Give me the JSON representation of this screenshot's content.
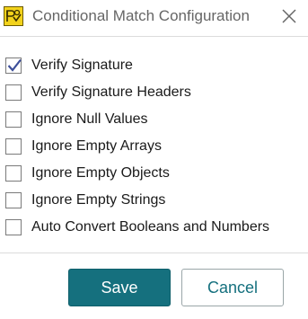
{
  "window": {
    "title": "Conditional Match Configuration",
    "icon": "app-logo-icon",
    "close_icon": "close-icon"
  },
  "options": [
    {
      "label": "Verify Signature",
      "checked": true
    },
    {
      "label": "Verify Signature Headers",
      "checked": false
    },
    {
      "label": "Ignore Null Values",
      "checked": false
    },
    {
      "label": "Ignore Empty Arrays",
      "checked": false
    },
    {
      "label": "Ignore Empty Objects",
      "checked": false
    },
    {
      "label": "Ignore Empty Strings",
      "checked": false
    },
    {
      "label": "Auto Convert Booleans and Numbers",
      "checked": false
    }
  ],
  "buttons": {
    "save_label": "Save",
    "cancel_label": "Cancel"
  },
  "colors": {
    "accent": "#15707e",
    "check": "#3d4f9a"
  }
}
